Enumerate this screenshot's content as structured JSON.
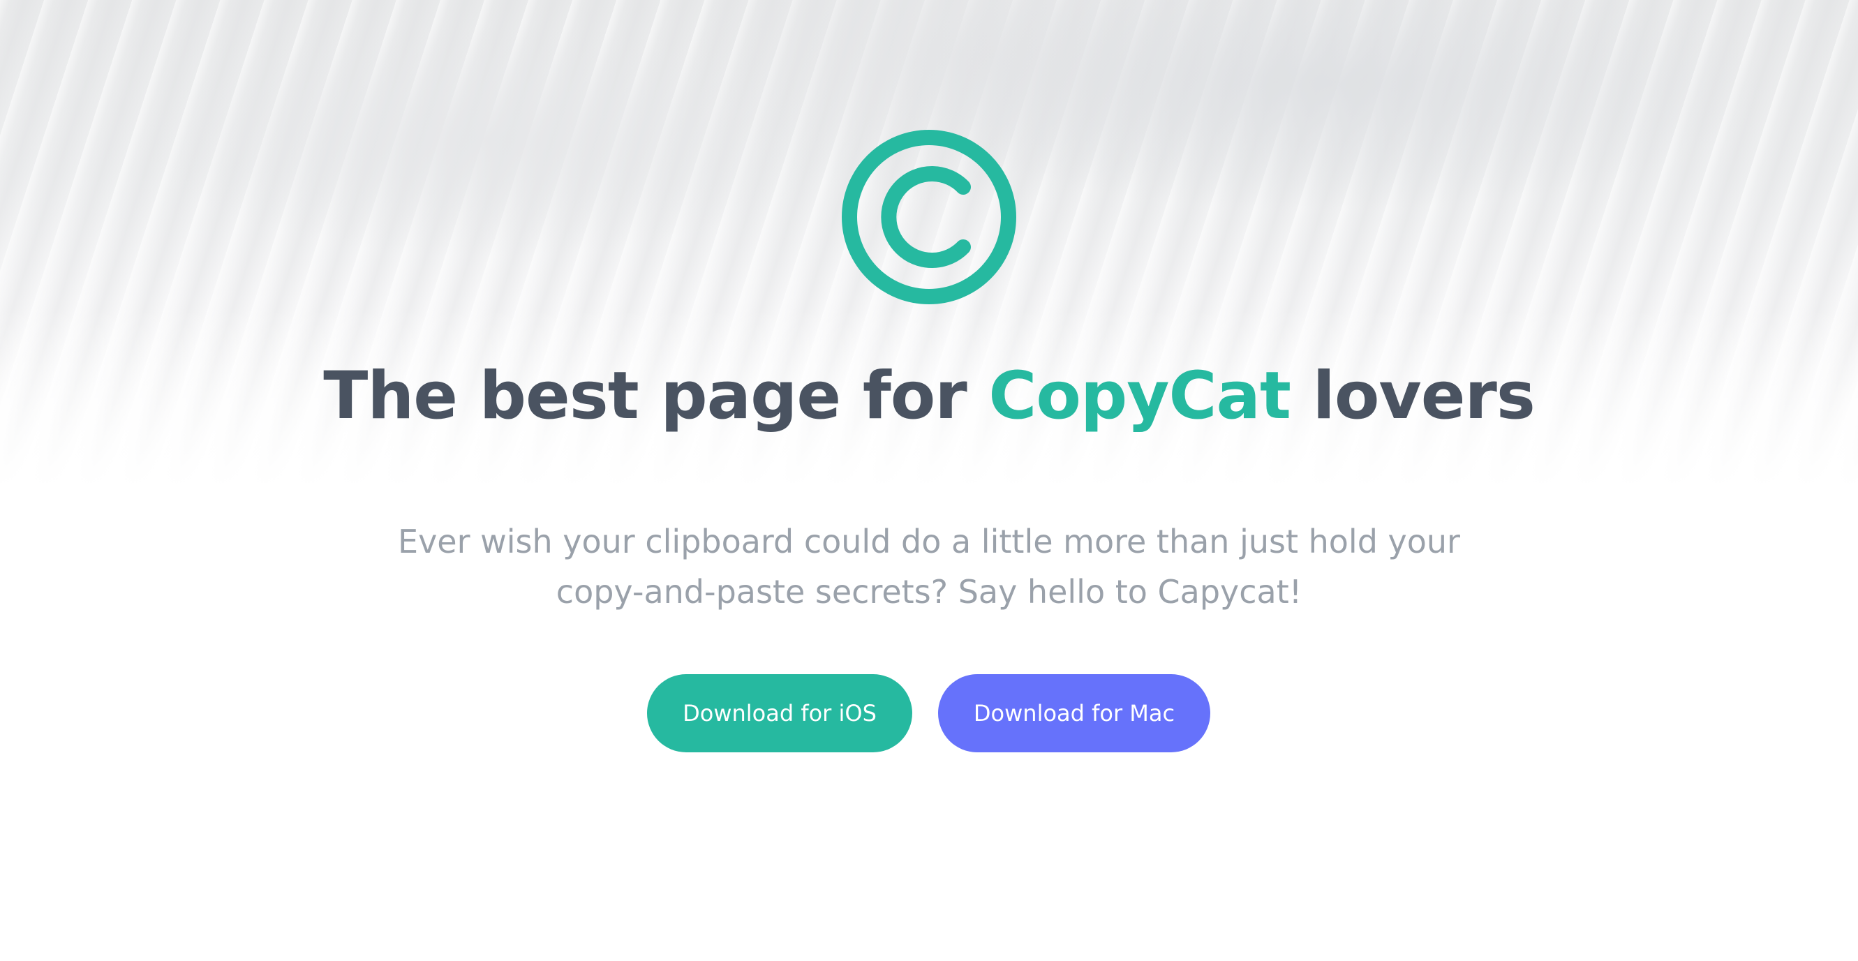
{
  "hero": {
    "headline_before": "The best page for ",
    "headline_accent": "CopyCat",
    "headline_after": " lovers",
    "subtitle": "Ever wish your clipboard could do a little more than just hold your copy-and-paste secrets? Say hello to Capycat!",
    "logo_icon": "copyright-icon"
  },
  "buttons": {
    "ios_label": "Download for iOS",
    "mac_label": "Download for Mac"
  },
  "colors": {
    "accent": "#26b9a0",
    "headline": "#4a5361",
    "subtitle": "#9aa1aa",
    "mac_button": "#6672fb"
  }
}
